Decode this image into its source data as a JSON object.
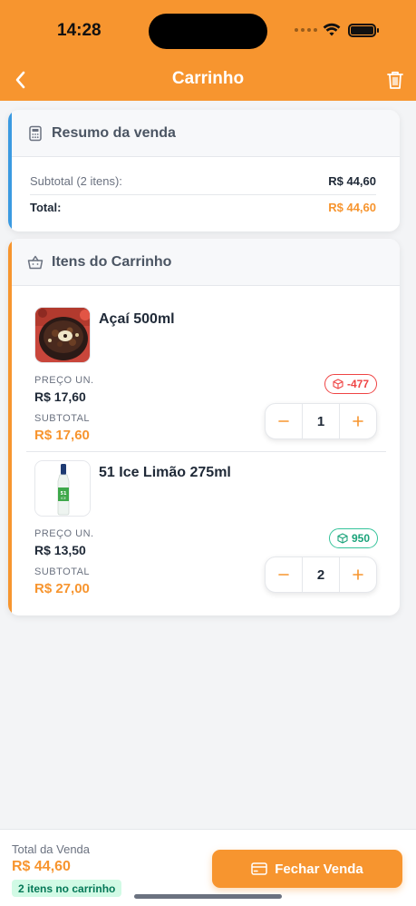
{
  "status_bar": {
    "time": "14:28"
  },
  "header": {
    "title": "Carrinho",
    "back_icon": "chevron-left-icon",
    "trash_icon": "trash-icon"
  },
  "summary": {
    "title": "Resumo da venda",
    "icon": "calculator-icon",
    "subtotal_label": "Subtotal (2 itens):",
    "subtotal_value": "R$ 44,60",
    "total_label": "Total:",
    "total_value": "R$ 44,60"
  },
  "cart": {
    "title": "Itens do Carrinho",
    "icon": "basket-icon",
    "items": [
      {
        "name": "Açaí 500ml",
        "price_label": "PREÇO UN.",
        "price": "R$ 17,60",
        "subtotal_label": "SUBTOTAL",
        "subtotal": "R$ 17,60",
        "stock": "-477",
        "stock_status": "negative",
        "quantity": "1"
      },
      {
        "name": "51 Ice Limão 275ml",
        "price_label": "PREÇO UN.",
        "price": "R$ 13,50",
        "subtotal_label": "SUBTOTAL",
        "subtotal": "R$ 27,00",
        "stock": "950",
        "stock_status": "positive",
        "quantity": "2"
      }
    ]
  },
  "footer": {
    "total_label": "Total da Venda",
    "total_value": "R$ 44,60",
    "items_badge": "2 itens no carrinho",
    "checkout_label": "Fechar Venda",
    "checkout_icon": "credit-card-icon"
  },
  "colors": {
    "accent": "#f7952f",
    "summary_bar": "#3b9ae1",
    "negative": "#ef4444",
    "positive": "#34c39a"
  }
}
